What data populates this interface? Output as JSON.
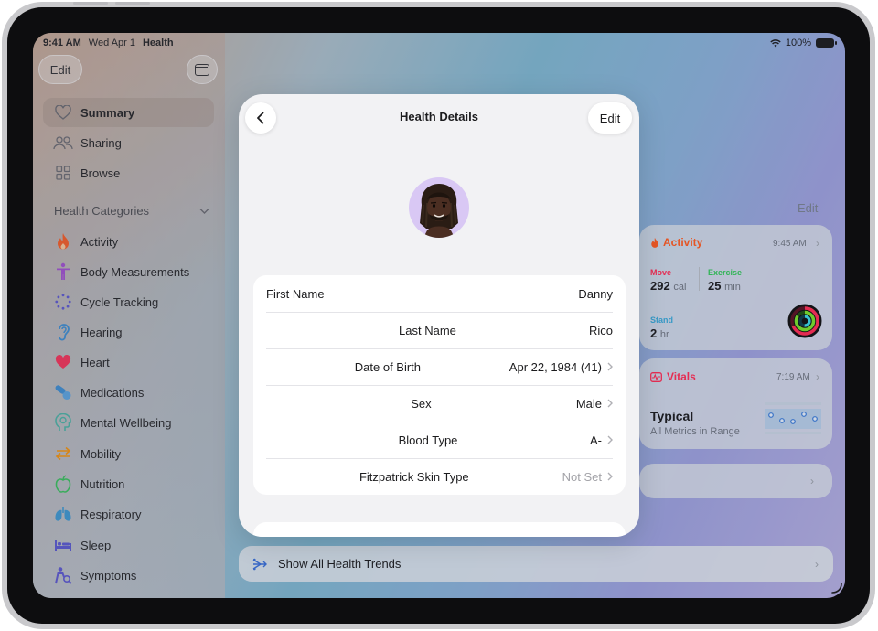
{
  "status": {
    "time": "9:41 AM",
    "date": "Wed Apr 1",
    "app": "Health",
    "battery": "100%"
  },
  "sidebar": {
    "edit_label": "Edit",
    "nav": [
      {
        "label": "Summary",
        "icon": "heart-outline-icon",
        "selected": true
      },
      {
        "label": "Sharing",
        "icon": "people-icon"
      },
      {
        "label": "Browse",
        "icon": "grid-icon"
      }
    ],
    "categories_header": "Health Categories",
    "categories": [
      {
        "label": "Activity",
        "icon": "flame-icon",
        "color": "#ff5a1f"
      },
      {
        "label": "Body Measurements",
        "icon": "figure-icon",
        "color": "#a64dd6"
      },
      {
        "label": "Cycle Tracking",
        "icon": "cycle-dots-icon",
        "color": "#5a55d6"
      },
      {
        "label": "Hearing",
        "icon": "ear-icon",
        "color": "#3a8fd8"
      },
      {
        "label": "Heart",
        "icon": "heart-icon",
        "color": "#ff2d55"
      },
      {
        "label": "Medications",
        "icon": "pills-icon",
        "color": "#3a8fd8"
      },
      {
        "label": "Mental Wellbeing",
        "icon": "head-icon",
        "color": "#49b8a8"
      },
      {
        "label": "Mobility",
        "icon": "arrows-icon",
        "color": "#ff9500"
      },
      {
        "label": "Nutrition",
        "icon": "apple-icon",
        "color": "#34c759"
      },
      {
        "label": "Respiratory",
        "icon": "lungs-icon",
        "color": "#3a9bd8"
      },
      {
        "label": "Sleep",
        "icon": "bed-icon",
        "color": "#5856d6"
      },
      {
        "label": "Symptoms",
        "icon": "person-search-icon",
        "color": "#5a55d6"
      }
    ]
  },
  "content": {
    "edit_label": "Edit",
    "activity": {
      "title": "Activity",
      "time": "9:45 AM",
      "move_label": "Move",
      "move_value": "292",
      "move_unit": "cal",
      "exercise_label": "Exercise",
      "exercise_value": "25",
      "exercise_unit": "min",
      "stand_label": "Stand",
      "stand_value": "2",
      "stand_unit": "hr"
    },
    "vitals": {
      "title": "Vitals",
      "time": "7:19 AM",
      "status": "Typical",
      "sub": "All Metrics in Range"
    },
    "trends_label": "Show All Health Trends"
  },
  "modal": {
    "title": "Health Details",
    "edit_label": "Edit",
    "rows": [
      {
        "label": "First Name",
        "value": "Danny",
        "chevron": false,
        "muted": false
      },
      {
        "label": "Last Name",
        "value": "Rico",
        "chevron": false,
        "muted": false
      },
      {
        "label": "Date of Birth",
        "value": "Apr 22, 1984 (41)",
        "chevron": true,
        "muted": false
      },
      {
        "label": "Sex",
        "value": "Male",
        "chevron": true,
        "muted": false
      },
      {
        "label": "Blood Type",
        "value": "A-",
        "chevron": true,
        "muted": false
      },
      {
        "label": "Fitzpatrick Skin Type",
        "value": "Not Set",
        "chevron": true,
        "muted": true
      }
    ]
  }
}
